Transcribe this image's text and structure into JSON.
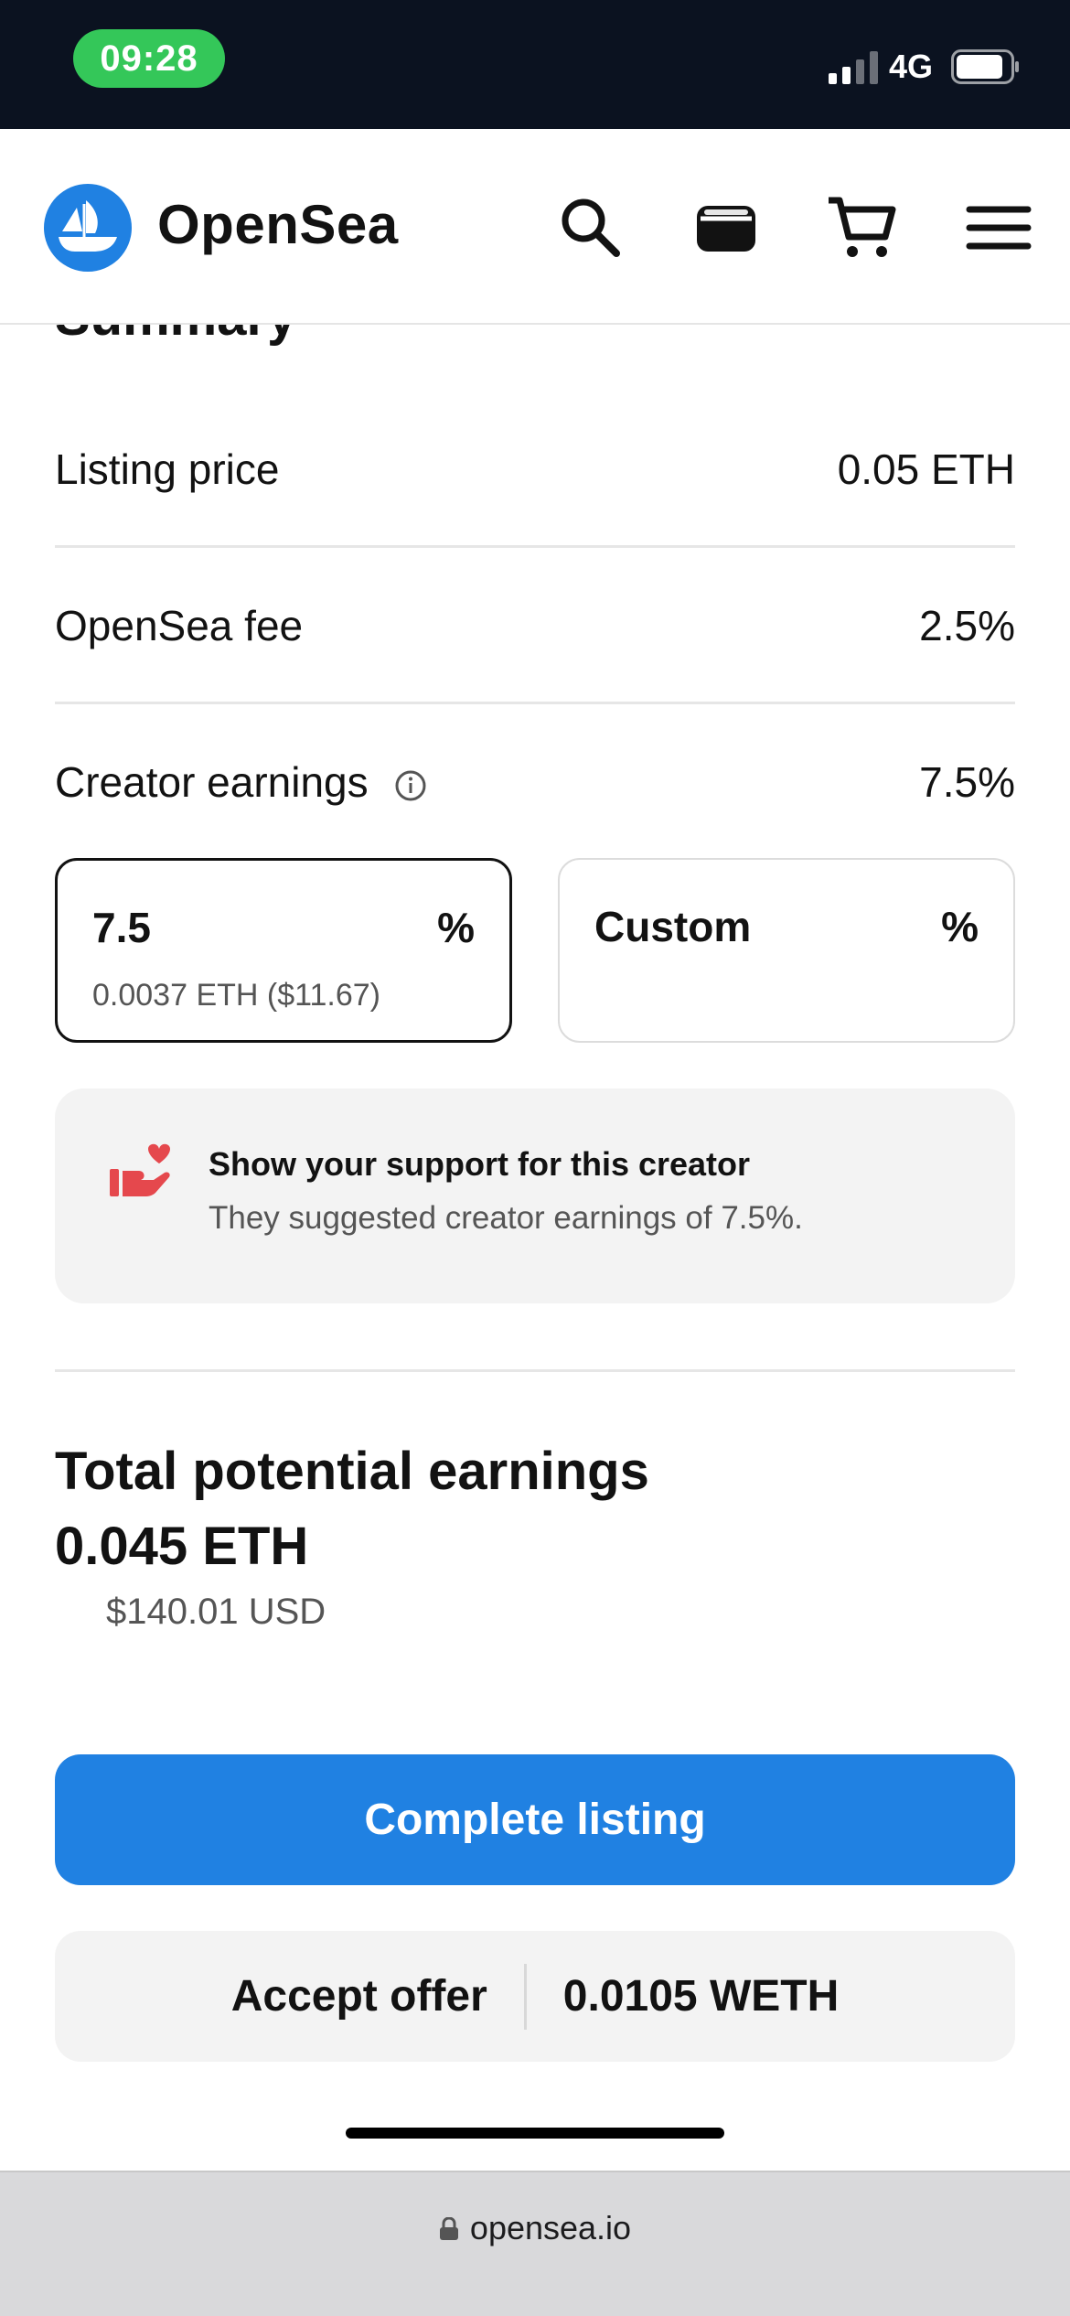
{
  "status_bar": {
    "time": "09:28",
    "network": "4G"
  },
  "header": {
    "brand": "OpenSea",
    "icons": [
      "search-icon",
      "wallet-icon",
      "cart-icon",
      "menu-icon"
    ]
  },
  "summary": {
    "title": "Summary",
    "listing_price_label": "Listing price",
    "listing_price_value": "0.05 ETH",
    "fee_label": "OpenSea fee",
    "fee_value": "2.5%",
    "creator_label": "Creator earnings",
    "creator_value": "7.5%"
  },
  "earnings_options": {
    "selected": {
      "value": "7.5",
      "unit": "%",
      "sub": "0.0037 ETH ($11.67)"
    },
    "custom": {
      "value": "Custom",
      "unit": "%"
    }
  },
  "support_box": {
    "title": "Show your support for this creator",
    "text": "They suggested creator earnings of 7.5%."
  },
  "total": {
    "title": "Total potential earnings",
    "eth": "0.045 ETH",
    "usd": "$140.01 USD"
  },
  "actions": {
    "complete_label": "Complete listing",
    "accept_label": "Accept offer",
    "offer_value": "0.0105 WETH"
  },
  "browser": {
    "url": "opensea.io"
  },
  "colors": {
    "accent": "#2081e2",
    "status_green": "#34c759",
    "status_bar_bg": "#0b1220"
  }
}
